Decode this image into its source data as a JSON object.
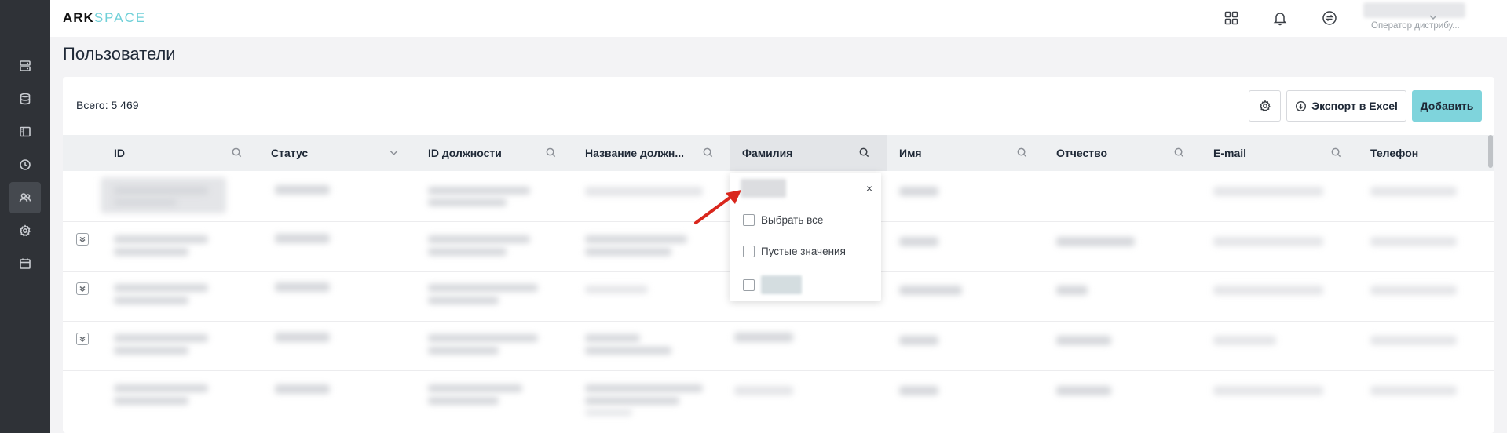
{
  "app": {
    "logo_part1": "ARK",
    "logo_part2": "SPACE"
  },
  "header": {
    "user_role": "Оператор дистрибу..."
  },
  "page": {
    "title": "Пользователи"
  },
  "toolbar": {
    "total_label": "Всего: 5 469",
    "export_label": "Экспорт в Excel",
    "add_label": "Добавить"
  },
  "table": {
    "columns": [
      {
        "label": "ID",
        "icon": "search-icon"
      },
      {
        "label": "Статус",
        "icon": "chevron-down-icon"
      },
      {
        "label": "ID должности",
        "icon": "search-icon"
      },
      {
        "label": "Название должн...",
        "icon": "search-icon"
      },
      {
        "label": "Фамилия",
        "icon": "search-icon"
      },
      {
        "label": "Имя",
        "icon": "search-icon"
      },
      {
        "label": "Отчество",
        "icon": "search-icon"
      },
      {
        "label": "E-mail",
        "icon": "search-icon"
      },
      {
        "label": "Телефон",
        "icon": ""
      }
    ]
  },
  "filter": {
    "options": [
      {
        "label": "Выбрать все"
      },
      {
        "label": "Пустые значения"
      }
    ],
    "close_glyph": "×"
  },
  "colors": {
    "accent": "#7fd4dc",
    "sidebar": "#2f3237",
    "annotation_arrow": "#d9261c"
  }
}
